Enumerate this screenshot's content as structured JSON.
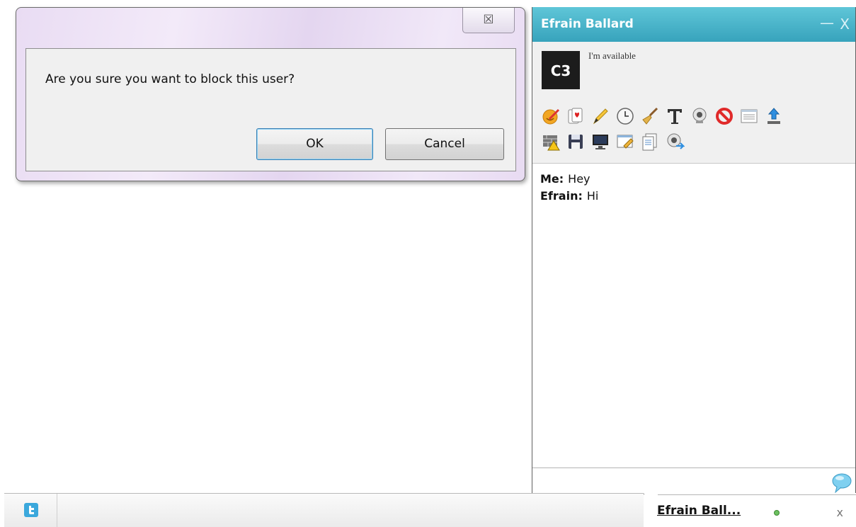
{
  "dialog": {
    "message": "Are you sure you want to block this user?",
    "ok_label": "OK",
    "cancel_label": "Cancel",
    "close_glyph": "☒"
  },
  "chat": {
    "title": "Efrain Ballard",
    "minimize_glyph": "—",
    "close_glyph": "X",
    "avatar_text": "C3",
    "status": "I'm available",
    "toolbar_row1": [
      "emoticon-icon",
      "cards-icon",
      "pencil-icon",
      "clock-icon",
      "broom-icon",
      "font-icon",
      "webcam-icon",
      "block-icon",
      "log-icon",
      "upload-icon"
    ],
    "toolbar_row2": [
      "warning-wall-icon",
      "save-icon",
      "screen-share-icon",
      "whiteboard-icon",
      "document-icon",
      "webcam-broadcast-icon"
    ],
    "messages": [
      {
        "sender": "Me:",
        "text": "Hey"
      },
      {
        "sender": "Efrain:",
        "text": "Hi"
      }
    ]
  },
  "bottombar": {
    "tab_name": "Efrain Ball...",
    "tab_close": "x",
    "status_color": "#6cc060"
  },
  "colors": {
    "header": "#4ab7cc",
    "dialog_frame": "#e9dcf3"
  }
}
